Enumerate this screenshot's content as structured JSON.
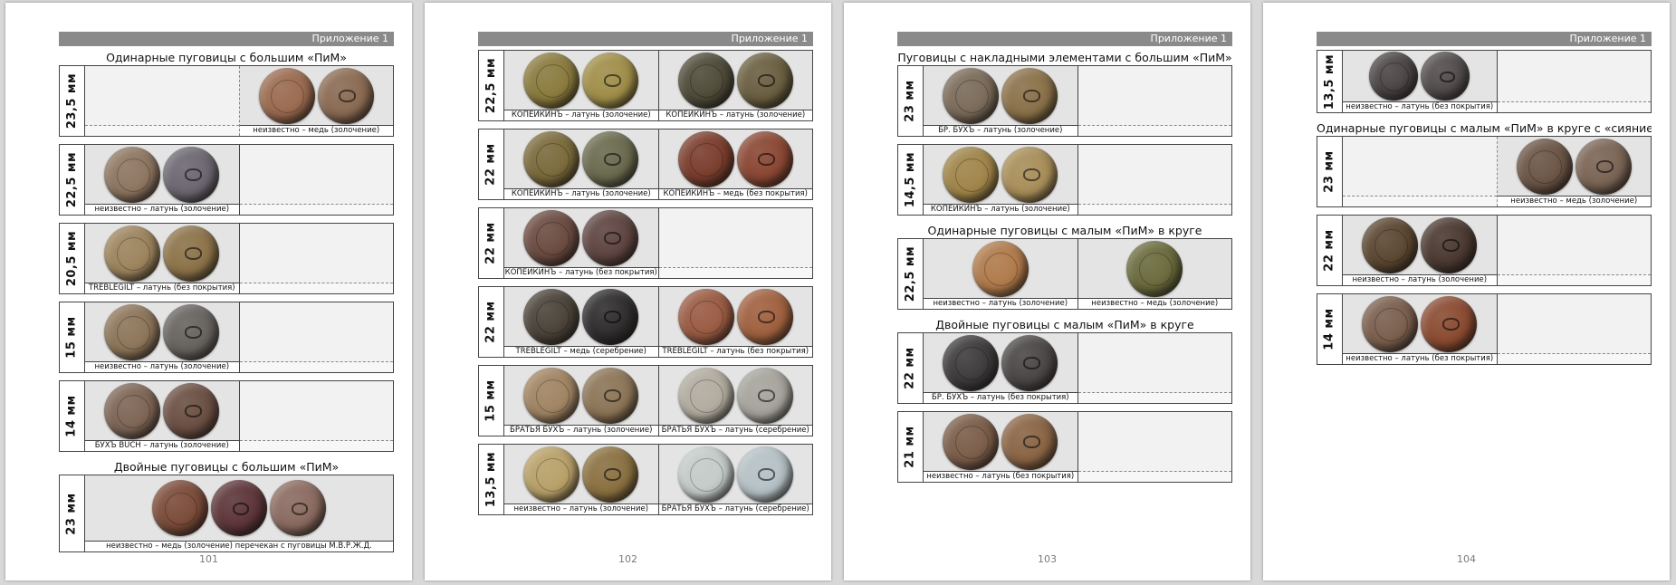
{
  "pages": [
    {
      "header": "Приложение 1",
      "number": "101",
      "blocks": [
        {
          "type": "title",
          "text": "Одинарные пуговицы с большим «ПиМ»"
        },
        {
          "type": "row",
          "size": "23,5 мм",
          "cells": [
            {
              "caption": "",
              "coins": []
            },
            {
              "caption": "неизвестно – медь (золочение)",
              "coins": [
                "#9a6a4e",
                "#8a6a52"
              ]
            }
          ]
        },
        {
          "type": "row",
          "size": "22,5 мм",
          "cells": [
            {
              "caption": "неизвестно – латунь (золочение)",
              "coins": [
                "#8d7560",
                "#6b6670"
              ]
            },
            {
              "caption": "",
              "coins": []
            }
          ]
        },
        {
          "type": "row",
          "size": "20,5 мм",
          "cells": [
            {
              "caption": "TREBLEGILT – латунь (без покрытия)",
              "coins": [
                "#9c835c",
                "#8c7248"
              ]
            },
            {
              "caption": "",
              "coins": []
            }
          ]
        },
        {
          "type": "row",
          "size": "15 мм",
          "cells": [
            {
              "caption": "неизвестно – латунь (золочение)",
              "coins": [
                "#8c7458",
                "#66625e"
              ]
            },
            {
              "caption": "",
              "coins": []
            }
          ]
        },
        {
          "type": "row",
          "size": "14 мм",
          "cells": [
            {
              "caption": "БУХЪ BUCH – латунь (золочение)",
              "coins": [
                "#7d6454",
                "#6a4e42"
              ]
            },
            {
              "caption": "",
              "coins": []
            }
          ]
        },
        {
          "type": "title",
          "text": "Двойные пуговицы с большим «ПиМ»"
        },
        {
          "type": "row",
          "size": "23 мм",
          "wide": true,
          "cells": [
            {
              "caption": "неизвестно – медь (золочение) перечекан с пуговицы М.В.Р.Ж.Д.",
              "coins": [
                "#7a4a38",
                "#5c3438",
                "#8a6a60"
              ]
            }
          ]
        }
      ]
    },
    {
      "header": "Приложение 1",
      "number": "102",
      "blocks": [
        {
          "type": "row",
          "size": "22,5 мм",
          "cells": [
            {
              "caption": "КОПЕИКИНЪ – латунь (золочение)",
              "coins": [
                "#8a7a3c",
                "#a08e48"
              ]
            },
            {
              "caption": "КОПЕИКИНЪ – латунь (золочение)",
              "coins": [
                "#4e4a38",
                "#6a5e40"
              ]
            }
          ]
        },
        {
          "type": "row",
          "size": "22 мм",
          "cells": [
            {
              "caption": "КОПЕИКИНЪ – латунь (золочение)",
              "coins": [
                "#7a6a3a",
                "#6a6a4e"
              ]
            },
            {
              "caption": "КОПЕИКИНЪ – медь (без покрытия)",
              "coins": [
                "#7a3c2c",
                "#8a4632"
              ]
            }
          ]
        },
        {
          "type": "row",
          "size": "22 мм",
          "cells": [
            {
              "caption": "КОПЕИКИНЪ – латунь (без покрытия)",
              "coins": [
                "#6a4a40",
                "#5e4440"
              ]
            },
            {
              "caption": "",
              "coins": []
            }
          ]
        },
        {
          "type": "row",
          "size": "22 мм",
          "cells": [
            {
              "caption": "TREBLEGILT – медь (серебрение)",
              "coins": [
                "#4a4238",
                "#2e2c2c"
              ]
            },
            {
              "caption": "TREBLEGILT – латунь (без покрытия)",
              "coins": [
                "#9a5a42",
                "#a0603e"
              ]
            }
          ]
        },
        {
          "type": "row",
          "size": "15 мм",
          "cells": [
            {
              "caption": "БРАТЬЯ БУХЪ – латунь (золочение)",
              "coins": [
                "#a08462",
                "#8c7456"
              ]
            },
            {
              "caption": "БРАТЬЯ БУХЪ – латунь (серебрение)",
              "coins": [
                "#b2aca0",
                "#a6a49c"
              ]
            }
          ]
        },
        {
          "type": "row",
          "size": "13,5 мм",
          "cells": [
            {
              "caption": "неизвестно – латунь (золочение)",
              "coins": [
                "#b8a068",
                "#8a7040"
              ]
            },
            {
              "caption": "БРАТЬЯ БУХЪ – латунь (серебрение)",
              "coins": [
                "#c4ccca",
                "#b6c2c6"
              ]
            }
          ]
        }
      ]
    },
    {
      "header": "Приложение 1",
      "number": "103",
      "blocks": [
        {
          "type": "title",
          "text": "Пуговицы с накладными элементами с большим «ПиМ»"
        },
        {
          "type": "row",
          "size": "23 мм",
          "cells": [
            {
              "caption": "БР. БУХЪ – латунь (золочение)",
              "coins": [
                "#7a6a58",
                "#8a7048"
              ]
            },
            {
              "caption": "",
              "coins": []
            }
          ]
        },
        {
          "type": "row",
          "size": "14,5 мм",
          "cells": [
            {
              "caption": "КОПЕИКИНЪ – латунь (золочение)",
              "coins": [
                "#a08448",
                "#a88e58"
              ]
            },
            {
              "caption": "",
              "coins": []
            }
          ]
        },
        {
          "type": "title",
          "text": "Одинарные пуговицы с малым «ПиМ» в круге"
        },
        {
          "type": "row",
          "size": "22,5 мм",
          "cells": [
            {
              "caption": "неизвестно – латунь (золочение)",
              "coins": [
                "#b07a4a"
              ]
            },
            {
              "caption": "неизвестно – медь (золочение)",
              "coins": [
                "#6a6a3c"
              ]
            }
          ]
        },
        {
          "type": "title",
          "text": "Двойные пуговицы с малым «ПиМ» в круге"
        },
        {
          "type": "row",
          "size": "22 мм",
          "cells": [
            {
              "caption": "БР. БУХЪ – латунь (без покрытия)",
              "coins": [
                "#3c3a3a",
                "#4a4646"
              ]
            },
            {
              "caption": "",
              "coins": []
            }
          ]
        },
        {
          "type": "row",
          "size": "21 мм",
          "cells": [
            {
              "caption": "неизвестно – латунь (без покрытия)",
              "coins": [
                "#7a5c48",
                "#8a6444"
              ]
            },
            {
              "caption": "",
              "coins": []
            }
          ]
        }
      ]
    },
    {
      "header": "Приложение 1",
      "number": "104",
      "blocks": [
        {
          "type": "row",
          "size": "13,5 мм",
          "short": true,
          "cells": [
            {
              "caption": "неизвестно – латунь (без покрытия)",
              "coins": [
                "#4a4444",
                "#524c4c"
              ]
            },
            {
              "caption": "",
              "coins": []
            }
          ]
        },
        {
          "type": "title",
          "text": "Одинарные пуговицы с малым «ПиМ» в круге с «сиянием»"
        },
        {
          "type": "row",
          "size": "23 мм",
          "cells": [
            {
              "caption": "",
              "coins": []
            },
            {
              "caption": "неизвестно – медь (золочение)",
              "coins": [
                "#6a5444",
                "#7a6454"
              ]
            }
          ]
        },
        {
          "type": "row",
          "size": "22 мм",
          "cells": [
            {
              "caption": "неизвестно – латунь (золочение)",
              "coins": [
                "#5a4630",
                "#4a3830"
              ]
            },
            {
              "caption": "",
              "coins": []
            }
          ]
        },
        {
          "type": "row",
          "size": "14 мм",
          "cells": [
            {
              "caption": "неизвестно – латунь (без покрытия)",
              "coins": [
                "#7a5e4c",
                "#8a4a30"
              ]
            },
            {
              "caption": "",
              "coins": []
            }
          ]
        }
      ]
    }
  ]
}
